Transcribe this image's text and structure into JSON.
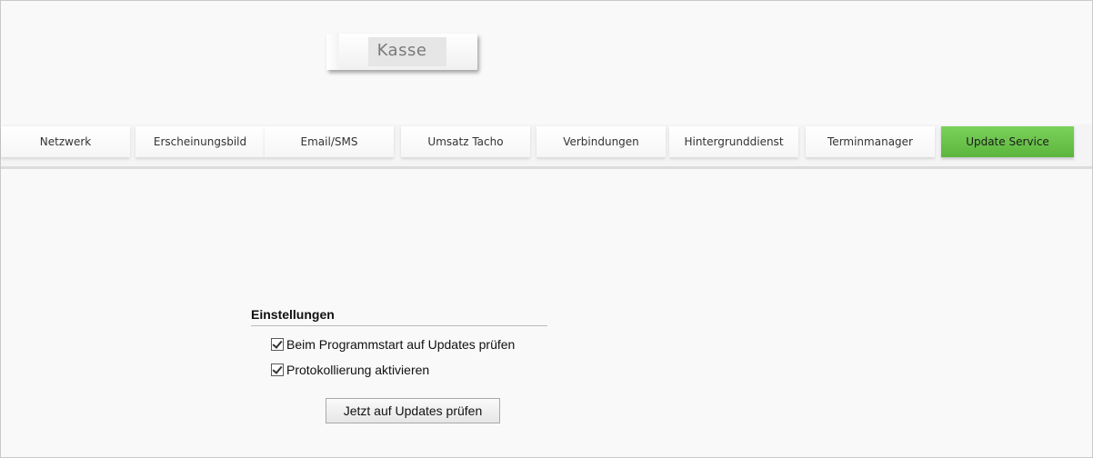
{
  "header": {
    "logo_text": "Kasse"
  },
  "tabs": [
    {
      "label": "Netzwerk"
    },
    {
      "label": "Erscheinungsbild"
    },
    {
      "label": "Email/SMS"
    },
    {
      "label": "Umsatz Tacho"
    },
    {
      "label": "Verbindungen"
    },
    {
      "label": "Hintergrunddienst"
    },
    {
      "label": "Terminmanager"
    },
    {
      "label": "Update Service"
    }
  ],
  "active_tab": "Update Service",
  "colors": {
    "active_tab": "#6ac64a"
  },
  "settings": {
    "title": "Einstellungen",
    "options": [
      {
        "label": "Beim Programmstart auf Updates prüfen",
        "checked": true
      },
      {
        "label": "Protokollierung aktivieren",
        "checked": true
      }
    ],
    "check_button": "Jetzt auf Updates prüfen"
  }
}
